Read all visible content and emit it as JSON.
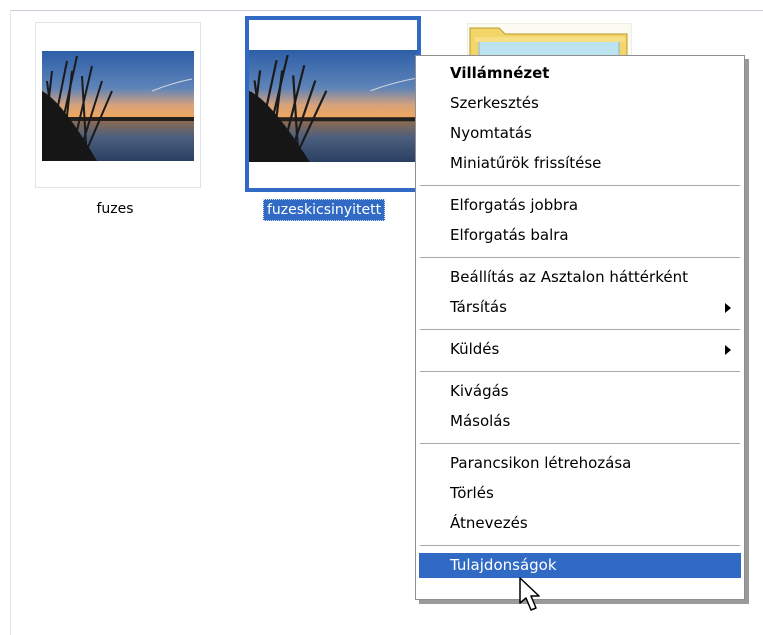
{
  "files": [
    {
      "name": "fuzes",
      "selected": false
    },
    {
      "name": "fuzeskicsinyitett",
      "selected": true
    }
  ],
  "folder": {
    "icon": "folder-icon"
  },
  "context_menu": {
    "groups": [
      {
        "items": [
          {
            "label": "Villámnézet",
            "bold": true
          },
          {
            "label": "Szerkesztés"
          },
          {
            "label": "Nyomtatás"
          },
          {
            "label": "Miniatűrök frissítése"
          }
        ]
      },
      {
        "items": [
          {
            "label": "Elforgatás jobbra"
          },
          {
            "label": "Elforgatás balra"
          }
        ]
      },
      {
        "items": [
          {
            "label": "Beállítás az Asztalon háttérként"
          },
          {
            "label": "Társítás",
            "submenu": true
          }
        ]
      },
      {
        "items": [
          {
            "label": "Küldés",
            "submenu": true
          }
        ]
      },
      {
        "items": [
          {
            "label": "Kivágás"
          },
          {
            "label": "Másolás"
          }
        ]
      },
      {
        "items": [
          {
            "label": "Parancsikon létrehozása"
          },
          {
            "label": "Törlés"
          },
          {
            "label": "Átnevezés"
          }
        ]
      },
      {
        "items": [
          {
            "label": "Tulajdonságok",
            "highlighted": true
          }
        ]
      }
    ]
  },
  "colors": {
    "selection": "#316ac5",
    "menu_border": "#8f8f8f",
    "folder_yellow": "#f3d56a"
  }
}
